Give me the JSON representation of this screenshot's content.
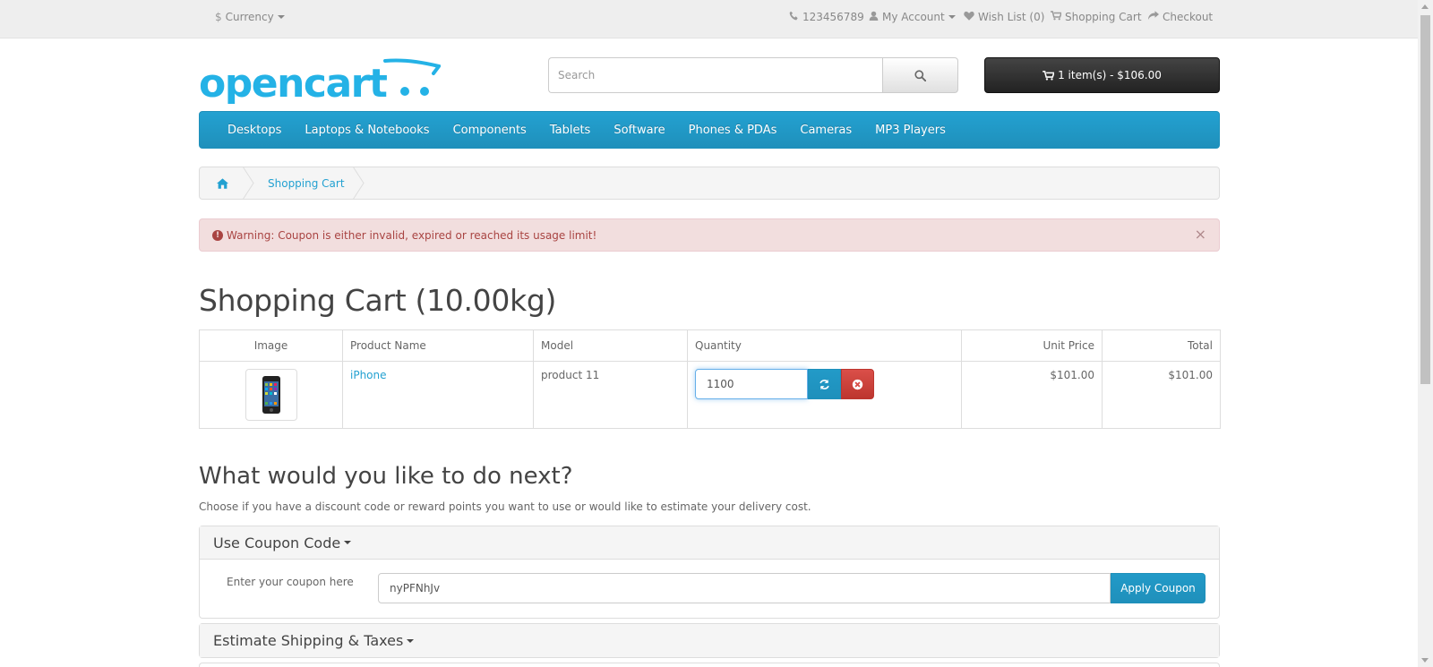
{
  "topbar": {
    "currency_symbol": "$",
    "currency_label": "Currency",
    "phone": "123456789",
    "my_account": "My Account",
    "wish_list": "Wish List (0)",
    "shopping_cart": "Shopping Cart",
    "checkout": "Checkout"
  },
  "header": {
    "logo_text": "opencart",
    "search_placeholder": "Search",
    "cart_button": "1 item(s) - $106.00"
  },
  "menu": {
    "items": [
      "Desktops",
      "Laptops & Notebooks",
      "Components",
      "Tablets",
      "Software",
      "Phones & PDAs",
      "Cameras",
      "MP3 Players"
    ]
  },
  "breadcrumb": {
    "current": "Shopping Cart"
  },
  "alert": {
    "text": "Warning: Coupon is either invalid, expired or reached its usage limit!",
    "close": "×"
  },
  "page": {
    "title": "Shopping Cart  (10.00kg)"
  },
  "cart_table": {
    "headers": {
      "image": "Image",
      "product_name": "Product Name",
      "model": "Model",
      "quantity": "Quantity",
      "unit_price": "Unit Price",
      "total": "Total"
    },
    "rows": [
      {
        "product_name": "iPhone",
        "model": "product 11",
        "quantity": "1100",
        "unit_price": "$101.00",
        "total": "$101.00"
      }
    ]
  },
  "next": {
    "title": "What would you like to do next?",
    "description": "Choose if you have a discount code or reward points you want to use or would like to estimate your delivery cost."
  },
  "coupon_panel": {
    "heading": "Use Coupon Code",
    "label": "Enter your coupon here",
    "value": "nyPFNhJv",
    "button": "Apply Coupon"
  },
  "shipping_panel": {
    "heading": "Estimate Shipping & Taxes"
  },
  "colors": {
    "brand_blue": "#23a1d1",
    "danger_red": "#da4f49",
    "alert_bg": "#f2dede",
    "alert_text": "#a94442",
    "cart_button_bg": "#333333"
  }
}
